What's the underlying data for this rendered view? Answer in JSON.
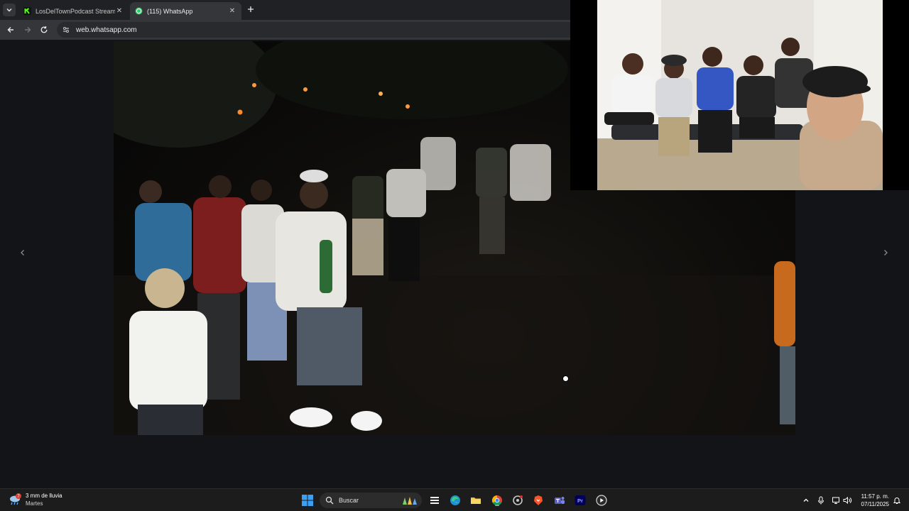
{
  "browser": {
    "tabs": [
      {
        "label": "LosDelTownPodcast Stream - W",
        "active": false,
        "favicon": "kick-icon"
      },
      {
        "label": "(115) WhatsApp",
        "active": true,
        "favicon": "whatsapp-icon"
      }
    ],
    "url": "web.whatsapp.com"
  },
  "viewer": {
    "media": "night-party-photo",
    "prev_icon": "chevron-left-icon",
    "next_icon": "chevron-right-icon"
  },
  "overlay": {
    "content": "webcam-feed"
  },
  "taskbar": {
    "weather": {
      "line1": "3 mm de lluvia",
      "line2": "Martes",
      "badge": "7"
    },
    "search_label": "Buscar",
    "time": "11:57 p. m.",
    "date": "07/11/2025",
    "colors": {
      "accent": "#0078d4",
      "whatsapp": "#25d366",
      "kick": "#53fc18"
    }
  }
}
